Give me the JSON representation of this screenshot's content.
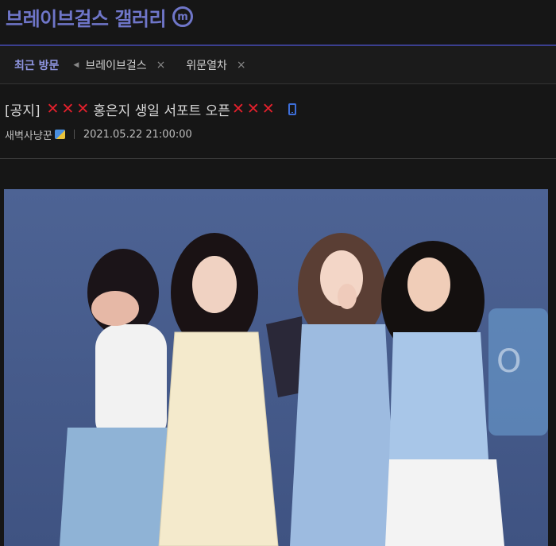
{
  "gallery": {
    "title": "브레이브걸스 갤러리",
    "badge": "m"
  },
  "recent": {
    "label": "최근 방문",
    "items": [
      {
        "name": "브레이브걸스",
        "close": "×"
      },
      {
        "name": "위문열차",
        "close": "×"
      }
    ]
  },
  "post": {
    "prefix": "[공지]",
    "x_mark": "✕",
    "title_text": "홍은지 생일 서포트 오픈",
    "author": "새벽사냥꾼",
    "date": "2021.05.22 21:00:00"
  },
  "colors": {
    "accent": "#6f76c9",
    "x_mark": "#e3202c",
    "mobile_icon": "#3d6ed8",
    "photo_bg": "#4a5f8c"
  },
  "icons": {
    "gallery_badge": "minor-gallery-badge-icon",
    "prev": "triangle-left-icon",
    "mobile": "mobile-phone-icon",
    "author_badge": "fixed-nickname-badge-icon"
  }
}
